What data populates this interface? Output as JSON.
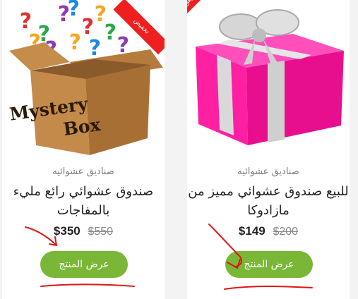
{
  "products": [
    {
      "badge": "تخفيض",
      "category": "صناديق عشوائيه",
      "title": "صندوق عشوائي رائع مليء بالمفاجات",
      "price_sale": "$350",
      "price_old": "$550",
      "button_label": "عرض المنتج",
      "image_text_line1": "Mystery",
      "image_text_line2": "Box"
    },
    {
      "badge": "تخفيض",
      "category": "صناديق عشوائيه",
      "title": "للبيع صندوق عشوائي مميز من مازادوكا",
      "price_sale": "$149",
      "price_old": "$200",
      "button_label": "عرض المنتج"
    }
  ],
  "colors": {
    "button": "#7ab737",
    "badge": "#ef1f1f",
    "gift_pink": "#ff1fa3",
    "annotation_red": "#e01515"
  }
}
